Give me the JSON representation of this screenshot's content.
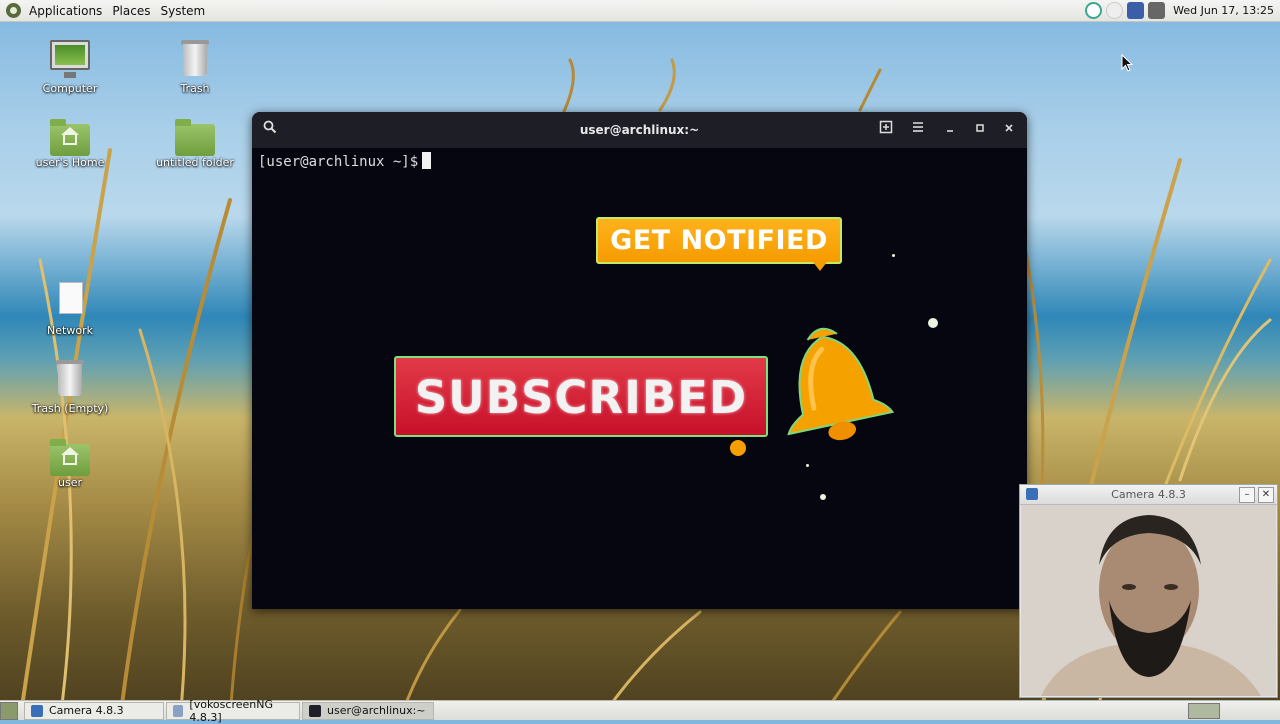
{
  "top_panel": {
    "menus": [
      "Applications",
      "Places",
      "System"
    ],
    "clock": "Wed Jun 17, 13:25"
  },
  "desktop_icons": [
    {
      "label": "Computer"
    },
    {
      "label": "Trash"
    },
    {
      "label": "user's Home"
    },
    {
      "label": "untitled folder"
    },
    {
      "label": "Network"
    },
    {
      "label": "Trash (Empty)"
    },
    {
      "label": "user"
    }
  ],
  "terminal": {
    "title": "user@archlinux:~",
    "prompt": "[user@archlinux ~]$"
  },
  "overlay": {
    "notify_text": "GET NOTIFIED",
    "subscribed_text": "SUBSCRIBED"
  },
  "camera_window": {
    "title": "Camera 4.8.3"
  },
  "taskbar": {
    "tasks": [
      {
        "label": "Camera 4.8.3"
      },
      {
        "label": "[vokoscreenNG 4.8.3]"
      },
      {
        "label": "user@archlinux:~"
      }
    ]
  },
  "colors": {
    "accent_orange": "#f59c00",
    "subscribe_red": "#c7102a",
    "terminal_bg": "#060611"
  }
}
